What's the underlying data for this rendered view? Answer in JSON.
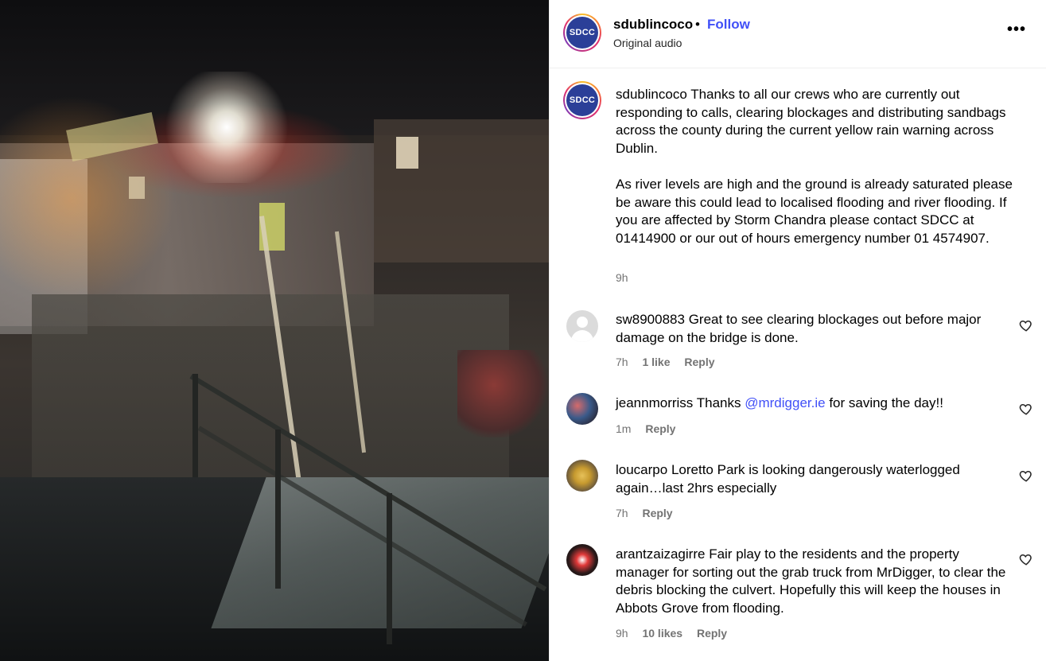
{
  "header": {
    "avatar_text": "SDCC",
    "username": "sdublincoco",
    "dot": "•",
    "follow_label": "Follow",
    "audio": "Original audio",
    "more": "•••"
  },
  "caption": {
    "avatar_text": "SDCC",
    "username": "sdublincoco",
    "paragraph1": "Thanks to all our crews who are currently out responding to calls, clearing blockages and distributing sandbags across the county during the current yellow rain warning across Dublin.",
    "paragraph2": "As river levels are high and the ground is already saturated please be aware this could lead to localised flooding and river flooding. If you are affected by Storm Chandra please contact SDCC at 01414900 or our out of hours emergency number 01 4574907.",
    "time": "9h"
  },
  "comments": [
    {
      "username": "sw8900883",
      "text": "Great to see clearing blockages out before major damage on the bridge is done.",
      "time": "7h",
      "likes": "1 like",
      "reply": "Reply"
    },
    {
      "username": "jeannmorriss",
      "text_before": "Thanks",
      "mention": "@mrdigger.ie",
      "text_after": "for saving the day!!",
      "time": "1m",
      "reply": "Reply"
    },
    {
      "username": "loucarpo",
      "text": "Loretto Park is looking dangerously waterlogged again…last 2hrs especially",
      "time": "7h",
      "reply": "Reply"
    },
    {
      "username": "arantzaizagirre",
      "text": "Fair play to the residents and the property manager for sorting out the grab truck from MrDigger, to clear the debris blocking the culvert. Hopefully this will keep the houses in Abbots Grove from flooding.",
      "time": "9h",
      "likes": "10 likes",
      "reply": "Reply"
    }
  ],
  "colors": {
    "link": "#4150f7",
    "muted": "#737373",
    "logo_bg": "#2b3f98"
  }
}
